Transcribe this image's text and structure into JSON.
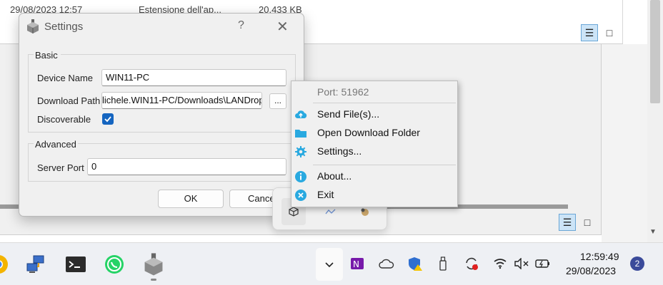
{
  "background_window": {
    "file_row": {
      "date": "29/08/2023 12:57",
      "type": "Estensione dell'ap...",
      "size": "20.433 KB"
    }
  },
  "settings_dialog": {
    "title": "Settings",
    "help_glyph": "?",
    "basic_group": {
      "label": "Basic",
      "device_name_label": "Device Name",
      "device_name_value": "WIN11-PC",
      "download_path_label": "Download Path",
      "download_path_value": "lichele.WIN11-PC/Downloads\\LANDrop",
      "browse_label": "...",
      "discoverable_label": "Discoverable",
      "discoverable_checked": true
    },
    "advanced_group": {
      "label": "Advanced",
      "server_port_label": "Server Port",
      "server_port_value": "0"
    },
    "ok_label": "OK",
    "cancel_label": "Cance"
  },
  "context_menu": {
    "header": "Port: 51962",
    "items": [
      {
        "label": "Send File(s)...",
        "icon": "cloud-upload-icon"
      },
      {
        "label": "Open Download Folder",
        "icon": "folder-icon"
      },
      {
        "label": "Settings...",
        "icon": "gear-icon"
      },
      {
        "label": "About...",
        "icon": "info-icon"
      },
      {
        "label": "Exit",
        "icon": "close-circle-icon"
      }
    ]
  },
  "taskbar": {
    "clock_time": "12:59:49",
    "clock_date": "29/08/2023",
    "notification_count": "2"
  },
  "colors": {
    "accent": "#1565c0",
    "menu_icon": "#29a9e0",
    "badge": "#3a4a9a"
  }
}
